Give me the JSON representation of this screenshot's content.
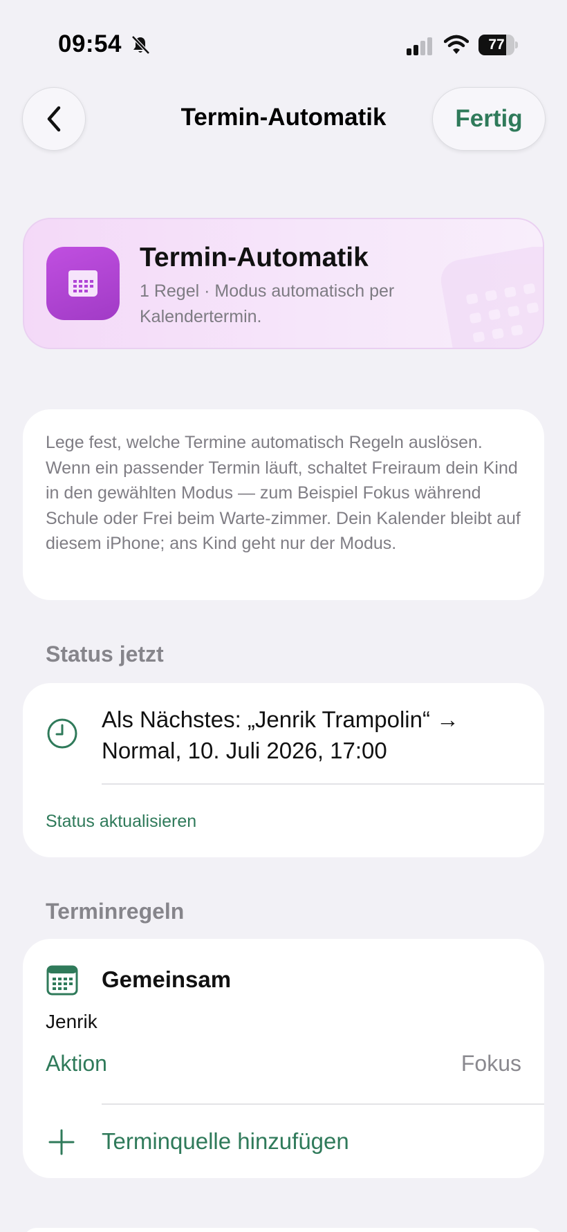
{
  "status_bar": {
    "time": "09:54",
    "battery": 77,
    "battery_label": "77",
    "icons": [
      "bell-slash-icon",
      "cellular-signal-icon",
      "wifi-icon",
      "battery-icon"
    ]
  },
  "nav": {
    "back_icon": "chevron-left-icon",
    "title": "Termin-Automatik",
    "done_label": "Fertig"
  },
  "header": {
    "icon": "calendar-icon",
    "title": "Termin-Automatik",
    "subtitle": "1 Regel · Modus automatisch per Kalendertermin."
  },
  "info": {
    "text": "Lege fest, welche Termine automatisch Regeln auslösen. Wenn ein passender Termin läuft, schaltet Freiraum dein Kind in den gewählten Modus — zum Beispiel Fokus während Schule oder Frei beim Warte-zimmer. Dein Kalender bleibt auf diesem iPhone; ans Kind geht nur der Modus."
  },
  "status_section": {
    "header": "Status jetzt",
    "icon": "clock-icon",
    "next_text": "Als Nächstes: „Jenrik Trampolin“ → Normal, 10. Juli 2026, 17:00",
    "refresh_label": "Status aktualisieren"
  },
  "rules_section": {
    "header": "Terminregeln",
    "rule": {
      "icon": "calendar-icon",
      "title": "Gemeinsam",
      "subtitle": "Jenrik",
      "action_label": "Aktion",
      "action_value": "Fokus"
    },
    "add_icon": "plus-icon",
    "add_label": "Terminquelle hinzufügen"
  },
  "colors": {
    "accent": "#2f7a5a",
    "purple": "#b045d6",
    "background": "#f2f1f6"
  }
}
